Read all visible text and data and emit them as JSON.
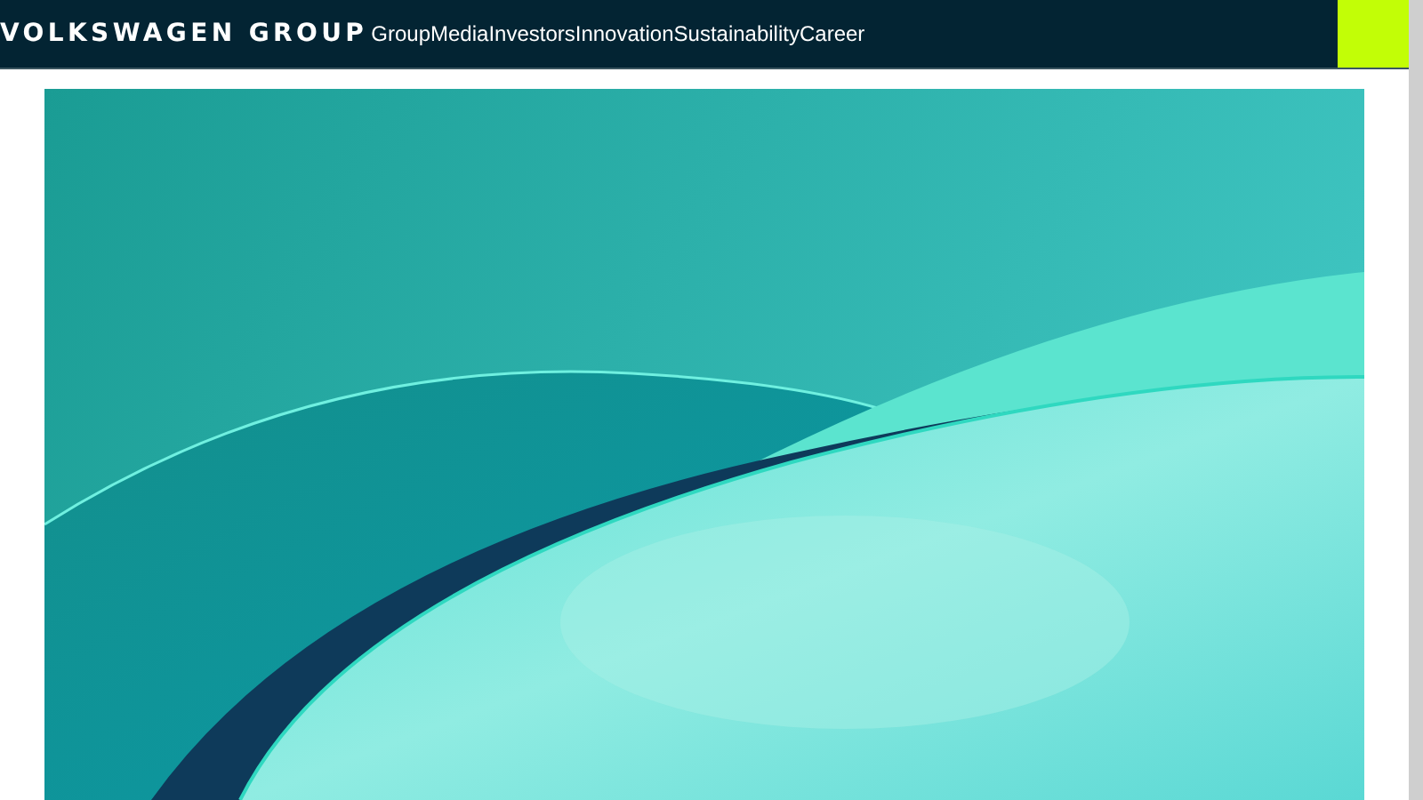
{
  "header": {
    "logo": "VOLKSWAGEN GROUP",
    "nav": [
      {
        "label": "Group"
      },
      {
        "label": "Media"
      },
      {
        "label": "Investors"
      },
      {
        "label": "Innovation"
      },
      {
        "label": "Sustainability"
      },
      {
        "label": "Career"
      }
    ]
  }
}
